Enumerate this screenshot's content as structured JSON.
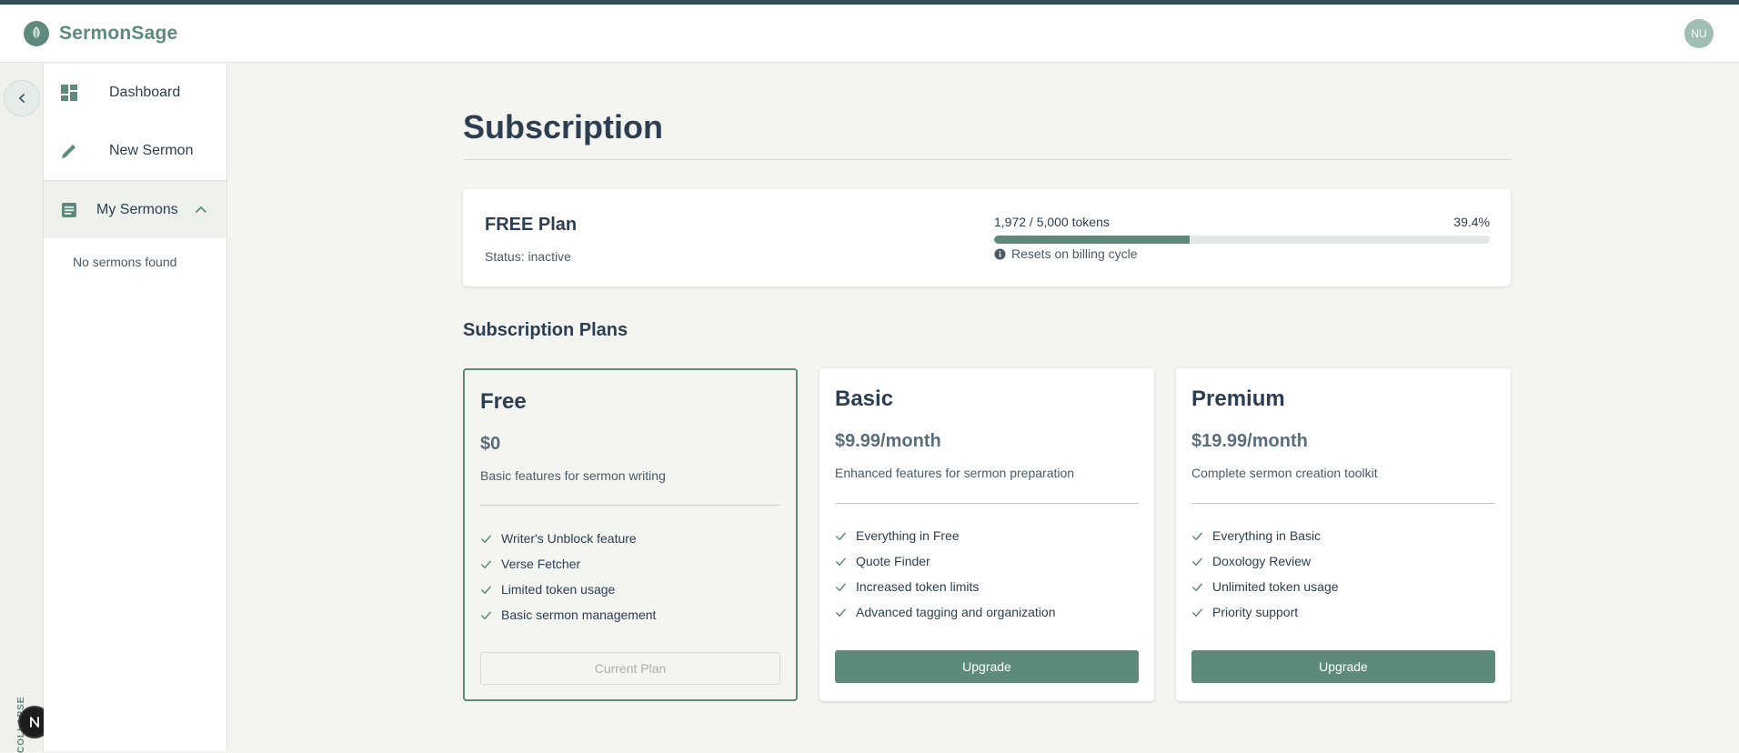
{
  "app": {
    "brand": "SermonSage",
    "avatar_initials": "NU"
  },
  "sidebar": {
    "items": [
      {
        "label": "Dashboard",
        "icon": "dashboard-icon"
      },
      {
        "label": "New Sermon",
        "icon": "pencil-icon"
      },
      {
        "label": "My Sermons",
        "icon": "document-icon",
        "expanded": true
      }
    ],
    "empty_note": "No sermons found",
    "rail_label": "COLLAPSE"
  },
  "page": {
    "title": "Subscription"
  },
  "usage": {
    "plan": "FREE Plan",
    "status": "Status: inactive",
    "tokens_text": "1,972 / 5,000 tokens",
    "percent_text": "39.4%",
    "used_fraction": 0.394,
    "reset_note": "Resets on billing cycle"
  },
  "plans_title": "Subscription Plans",
  "plans": [
    {
      "name": "Free",
      "price": "$0",
      "description": "Basic features for sermon writing",
      "features": [
        "Writer's Unblock feature",
        "Verse Fetcher",
        "Limited token usage",
        "Basic sermon management"
      ],
      "button": "Current Plan",
      "current": true
    },
    {
      "name": "Basic",
      "price": "$9.99/month",
      "description": "Enhanced features for sermon preparation",
      "features": [
        "Everything in Free",
        "Quote Finder",
        "Increased token limits",
        "Advanced tagging and organization"
      ],
      "button": "Upgrade",
      "current": false
    },
    {
      "name": "Premium",
      "price": "$19.99/month",
      "description": "Complete sermon creation toolkit",
      "features": [
        "Everything in Basic",
        "Doxology Review",
        "Unlimited token usage",
        "Priority support"
      ],
      "button": "Upgrade",
      "current": false
    }
  ],
  "colors": {
    "accent": "#5e8a7b",
    "text": "#2c3e50",
    "background": "#f4f4f0"
  }
}
